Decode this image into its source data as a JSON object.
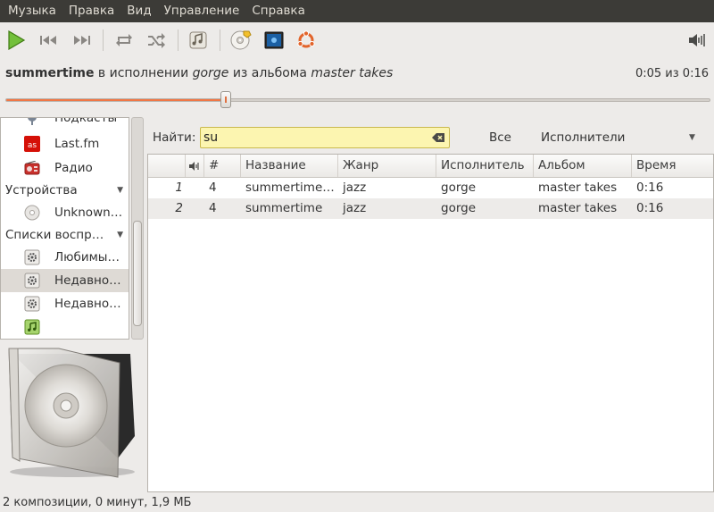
{
  "menu": [
    "Музыка",
    "Правка",
    "Вид",
    "Управление",
    "Справка"
  ],
  "toolbar": {
    "icons": [
      "play-icon",
      "previous-icon",
      "next-icon",
      "repeat-icon",
      "shuffle-icon",
      "music-icon",
      "cd-icon",
      "visualization-icon",
      "ubuntu-one-icon",
      "volume-icon"
    ],
    "accent": "#4e9a06"
  },
  "now_playing": {
    "song": "summertime",
    "by": "в исполнении",
    "artist": "gorge",
    "from": "из альбома",
    "album": "master takes",
    "time": "0:05 из 0:16",
    "progress": 0.3125
  },
  "sidebar": {
    "items": [
      {
        "label": "Подкасты",
        "icon": "podcast-icon"
      },
      {
        "label": "Last.fm",
        "icon": "lastfm-icon"
      },
      {
        "label": "Радио",
        "icon": "radio-icon"
      }
    ],
    "devices_header": "Устройства",
    "devices": [
      {
        "label": "Unknown…",
        "icon": "disc-icon"
      }
    ],
    "playlists_header": "Списки воспр…",
    "playlists": [
      {
        "label": "Любимы…",
        "icon": "smart-playlist-icon"
      },
      {
        "label": "Недавно…",
        "icon": "smart-playlist-icon",
        "selected": true
      },
      {
        "label": "Недавно…",
        "icon": "smart-playlist-icon"
      },
      {
        "label": "",
        "icon": "playlist-icon"
      }
    ]
  },
  "search": {
    "label": "Найти:",
    "value": "su",
    "filter_all": "Все",
    "filter_selected": "Исполнители"
  },
  "table": {
    "columns": [
      "",
      "#",
      "Название",
      "Жанр",
      "Исполнитель",
      "Альбом",
      "Время"
    ],
    "rows": [
      {
        "n": "1",
        "track": "4",
        "title": "summertime…",
        "genre": "jazz",
        "artist": "gorge",
        "album": "master takes",
        "time": "0:16"
      },
      {
        "n": "2",
        "track": "4",
        "title": "summertime",
        "genre": "jazz",
        "artist": "gorge",
        "album": "master takes",
        "time": "0:16"
      }
    ]
  },
  "status": "2 композиции, 0 минут, 1,9 МБ"
}
